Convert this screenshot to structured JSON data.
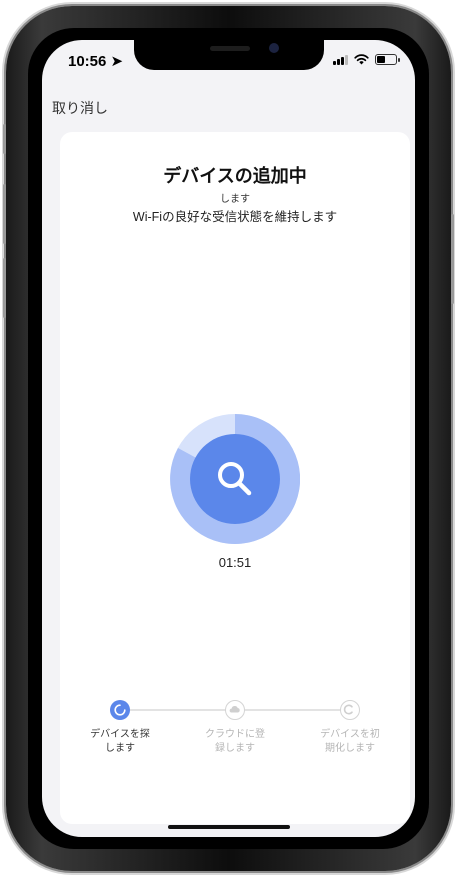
{
  "status_bar": {
    "time": "10:56 ➤"
  },
  "nav": {
    "cancel_label": "取り消し"
  },
  "header": {
    "title": "デバイスの追加中",
    "subtitle_small": "します",
    "subtitle": "Wi-Fiの良好な受信状態を維持します"
  },
  "scan": {
    "timer": "01:51"
  },
  "steps": [
    {
      "label_line1": "デバイスを探",
      "label_line2": "します",
      "state": "active"
    },
    {
      "label_line1": "クラウドに登",
      "label_line2": "録します",
      "state": "pending"
    },
    {
      "label_line1": "デバイスを初",
      "label_line2": "期化します",
      "state": "pending"
    }
  ],
  "colors": {
    "accent": "#5b87ea",
    "accent_light": "#a9c0f7",
    "inactive": "#d4d4d4"
  }
}
